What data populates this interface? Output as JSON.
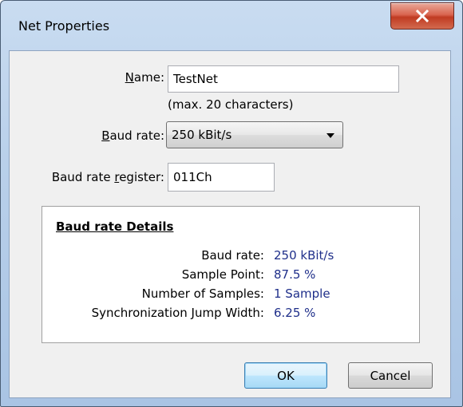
{
  "window": {
    "title": "Net Properties"
  },
  "form": {
    "name_label_mnemonic": "N",
    "name_label_rest": "ame:",
    "name_value": "TestNet",
    "name_hint": "(max. 20 characters)",
    "baud_label_mnemonic": "B",
    "baud_label_rest": "aud rate:",
    "baud_value": "250 kBit/s",
    "register_label_prefix": "Baud rate ",
    "register_label_mnemonic": "r",
    "register_label_rest": "egister:",
    "register_value": "011Ch"
  },
  "details": {
    "title": "Baud rate Details",
    "rows": [
      {
        "label": "Baud rate:",
        "value": "250 kBit/s"
      },
      {
        "label": "Sample Point:",
        "value": "87.5 %"
      },
      {
        "label": "Number of Samples:",
        "value": "1 Sample"
      },
      {
        "label": "Synchronization Jump Width:",
        "value": "6.25 %"
      }
    ]
  },
  "buttons": {
    "ok": "OK",
    "cancel": "Cancel"
  },
  "icons": {
    "close": "close-x-icon",
    "dropdown": "chevron-down-icon"
  },
  "colors": {
    "detail_value": "#1f2f8a",
    "close_button": "#c03b22",
    "default_button_border": "#3c7fb1"
  }
}
